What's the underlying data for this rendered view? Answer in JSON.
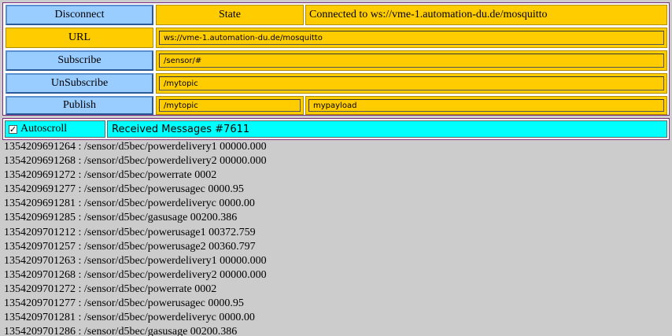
{
  "controls": {
    "disconnect_label": "Disconnect",
    "state_label": "State",
    "state_value": "Connected to ws://vme-1.automation-du.de/mosquitto",
    "url_label": "URL",
    "url_value": "ws://vme-1.automation-du.de/mosquitto",
    "subscribe_label": "Subscribe",
    "subscribe_topic": "/sensor/#",
    "unsubscribe_label": "UnSubscribe",
    "unsubscribe_topic": "/mytopic",
    "publish_label": "Publish",
    "publish_topic": "/mytopic",
    "publish_payload": "mypayload"
  },
  "messages_panel": {
    "autoscroll_label": "Autoscroll",
    "autoscroll_checked": true,
    "checkbox_glyph": "✓",
    "received_label": "Received Messages #7611",
    "items": [
      "1354209691264 : /sensor/d5bec/powerdelivery1 00000.000",
      "1354209691268 : /sensor/d5bec/powerdelivery2 00000.000",
      "1354209691272 : /sensor/d5bec/powerrate 0002",
      "1354209691277 : /sensor/d5bec/powerusagec 0000.95",
      "1354209691281 : /sensor/d5bec/powerdeliveryc 0000.00",
      "1354209691285 : /sensor/d5bec/gasusage 00200.386",
      "1354209701212 : /sensor/d5bec/powerusage1 00372.759",
      "1354209701257 : /sensor/d5bec/powerusage2 00360.797",
      "1354209701263 : /sensor/d5bec/powerdelivery1 00000.000",
      "1354209701268 : /sensor/d5bec/powerdelivery2 00000.000",
      "1354209701272 : /sensor/d5bec/powerrate 0002",
      "1354209701277 : /sensor/d5bec/powerusagec 0000.95",
      "1354209701281 : /sensor/d5bec/powerdeliveryc 0000.00",
      "1354209701286 : /sensor/d5bec/gasusage 00200.386"
    ]
  },
  "colors": {
    "button_blue": "#99ccff",
    "field_orange": "#ffcc00",
    "header_cyan": "#00ffff",
    "log_background": "#cccccc",
    "border_purple": "#7a2a7a"
  }
}
